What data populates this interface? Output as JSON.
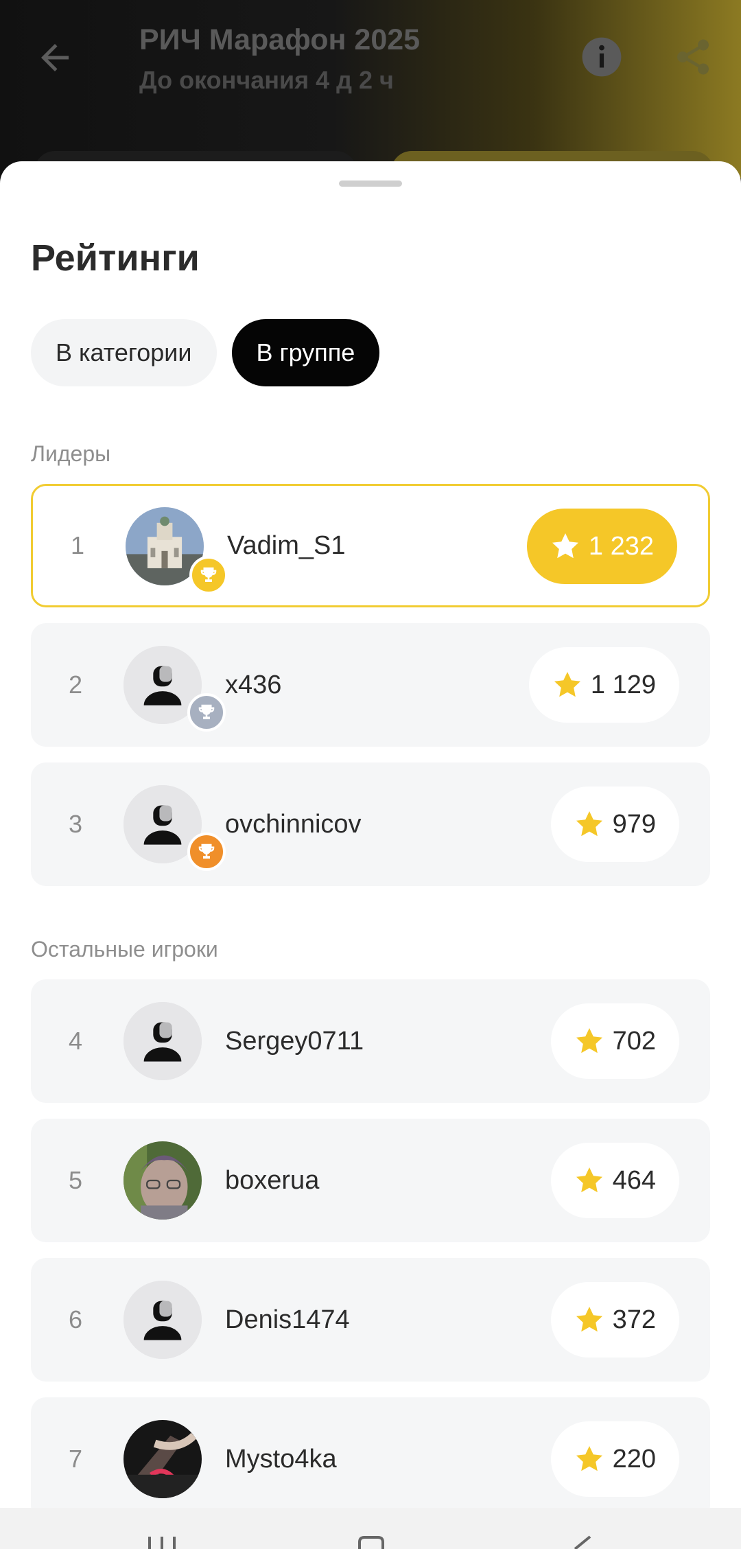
{
  "header": {
    "title": "РИЧ Марафон 2025",
    "subtitle": "До окончания 4 д 2 ч"
  },
  "sheet": {
    "title": "Рейтинги",
    "tabs": [
      {
        "label": "В категории",
        "active": false
      },
      {
        "label": "В группе",
        "active": true
      }
    ],
    "leaders_label": "Лидеры",
    "others_label": "Остальные игроки"
  },
  "leaders": [
    {
      "rank": "1",
      "name": "Vadim_S1",
      "score": "1 232",
      "avatar": "photo-church",
      "trophy": "gold"
    },
    {
      "rank": "2",
      "name": "x436",
      "score": "1 129",
      "avatar": "default-user",
      "trophy": "silver"
    },
    {
      "rank": "3",
      "name": "ovchinnicov",
      "score": "979",
      "avatar": "default-user",
      "trophy": "bronze"
    }
  ],
  "others": [
    {
      "rank": "4",
      "name": "Sergey0711",
      "score": "702",
      "avatar": "default-user"
    },
    {
      "rank": "5",
      "name": "boxerua",
      "score": "464",
      "avatar": "photo-person"
    },
    {
      "rank": "6",
      "name": "Denis1474",
      "score": "372",
      "avatar": "default-user"
    },
    {
      "rank": "7",
      "name": "Mysto4ka",
      "score": "220",
      "avatar": "photo-dark"
    }
  ],
  "colors": {
    "accent_yellow": "#f5c728",
    "leader_border": "#f1cc32",
    "trophy_gold": "#f5c728",
    "trophy_silver": "#a7b0c0",
    "trophy_bronze": "#f08f2a",
    "row_bg": "#f5f6f7"
  },
  "icons": {
    "back": "arrow-left-icon",
    "info": "info-icon",
    "share": "share-icon",
    "score": "star-icon",
    "trophy": "trophy-icon"
  }
}
